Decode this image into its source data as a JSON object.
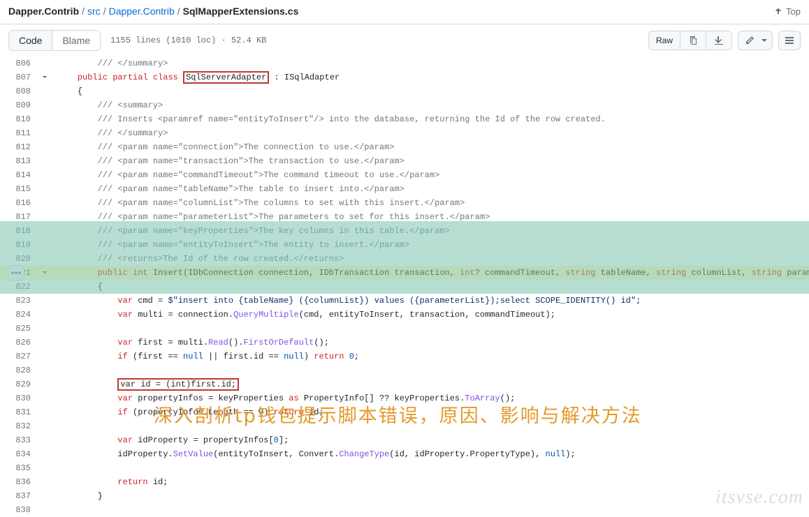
{
  "breadcrumb": {
    "items": [
      {
        "label": "Dapper.Contrib",
        "bold": true
      },
      {
        "label": "src"
      },
      {
        "label": "Dapper.Contrib"
      },
      {
        "label": "SqlMapperExtensions.cs",
        "bold": true
      }
    ],
    "sep": "/"
  },
  "top_link": "Top",
  "view_tabs": {
    "code": "Code",
    "blame": "Blame"
  },
  "file_meta": "1155 lines (1010 loc) · 52.4 KB",
  "actions": {
    "raw": "Raw"
  },
  "watermark": "itsvse.com",
  "overlay_text": "深入剖析tp钱包提示脚本错误，原因、影响与解决方法",
  "code": [
    {
      "n": "806",
      "g": "",
      "tokens": [
        {
          "t": "        ",
          "c": ""
        },
        {
          "t": "/// </summary>",
          "c": "c1"
        }
      ]
    },
    {
      "n": "807",
      "g": "chev",
      "tokens": [
        {
          "t": "    ",
          "c": ""
        },
        {
          "t": "public",
          "c": "kw"
        },
        {
          "t": " ",
          "c": ""
        },
        {
          "t": "partial",
          "c": "kw"
        },
        {
          "t": " ",
          "c": ""
        },
        {
          "t": "class",
          "c": "kw"
        },
        {
          "t": " ",
          "c": ""
        },
        {
          "t": "SqlServerAdapter",
          "c": "",
          "box": true
        },
        {
          "t": " : ISqlAdapter",
          "c": ""
        }
      ]
    },
    {
      "n": "808",
      "g": "",
      "tokens": [
        {
          "t": "    {",
          "c": ""
        }
      ]
    },
    {
      "n": "809",
      "g": "",
      "tokens": [
        {
          "t": "        ",
          "c": ""
        },
        {
          "t": "/// <summary>",
          "c": "c1"
        }
      ]
    },
    {
      "n": "810",
      "g": "",
      "tokens": [
        {
          "t": "        ",
          "c": ""
        },
        {
          "t": "/// Inserts <paramref name=\"entityToInsert\"/> into the database, returning the Id of the row created.",
          "c": "c1"
        }
      ]
    },
    {
      "n": "811",
      "g": "",
      "tokens": [
        {
          "t": "        ",
          "c": ""
        },
        {
          "t": "/// </summary>",
          "c": "c1"
        }
      ]
    },
    {
      "n": "812",
      "g": "",
      "tokens": [
        {
          "t": "        ",
          "c": ""
        },
        {
          "t": "/// <param name=\"connection\">The connection to use.</param>",
          "c": "c1"
        }
      ]
    },
    {
      "n": "813",
      "g": "",
      "tokens": [
        {
          "t": "        ",
          "c": ""
        },
        {
          "t": "/// <param name=\"transaction\">The transaction to use.</param>",
          "c": "c1"
        }
      ]
    },
    {
      "n": "814",
      "g": "",
      "tokens": [
        {
          "t": "        ",
          "c": ""
        },
        {
          "t": "/// <param name=\"commandTimeout\">The command timeout to use.</param>",
          "c": "c1"
        }
      ]
    },
    {
      "n": "815",
      "g": "",
      "tokens": [
        {
          "t": "        ",
          "c": ""
        },
        {
          "t": "/// <param name=\"tableName\">The table to insert into.</param>",
          "c": "c1"
        }
      ]
    },
    {
      "n": "816",
      "g": "",
      "tokens": [
        {
          "t": "        ",
          "c": ""
        },
        {
          "t": "/// <param name=\"columnList\">The columns to set with this insert.</param>",
          "c": "c1"
        }
      ]
    },
    {
      "n": "817",
      "g": "",
      "tokens": [
        {
          "t": "        ",
          "c": ""
        },
        {
          "t": "/// <param name=\"parameterList\">The parameters to set for this insert.</param>",
          "c": "c1"
        }
      ]
    },
    {
      "n": "818",
      "g": "",
      "tokens": [
        {
          "t": "        ",
          "c": ""
        },
        {
          "t": "/// <param name=\"keyProperties\">The key columns in this table.</param>",
          "c": "c1"
        }
      ]
    },
    {
      "n": "819",
      "g": "",
      "tokens": [
        {
          "t": "        ",
          "c": ""
        },
        {
          "t": "/// <param name=\"entityToInsert\">The entity to insert.</param>",
          "c": "c1"
        }
      ]
    },
    {
      "n": "820",
      "g": "",
      "tokens": [
        {
          "t": "        ",
          "c": ""
        },
        {
          "t": "/// <returns>The Id of the row created.</returns>",
          "c": "c1"
        }
      ]
    },
    {
      "n": "821",
      "g": "chev",
      "cur": true,
      "tokens": [
        {
          "t": "        ",
          "c": ""
        },
        {
          "t": "public",
          "c": "kw"
        },
        {
          "t": " ",
          "c": ""
        },
        {
          "t": "int",
          "c": "kw"
        },
        {
          "t": " ",
          "c": ""
        },
        {
          "t": "Insert",
          "c": "",
          "hl": true
        },
        {
          "t": "(IDbConnection connection, IDbTransaction transaction, ",
          "c": ""
        },
        {
          "t": "int",
          "c": "kw"
        },
        {
          "t": "? commandTimeout, ",
          "c": ""
        },
        {
          "t": "string",
          "c": "kw"
        },
        {
          "t": " tableName, ",
          "c": ""
        },
        {
          "t": "string",
          "c": "kw"
        },
        {
          "t": " columnList, ",
          "c": ""
        },
        {
          "t": "string",
          "c": "kw"
        },
        {
          "t": " parameterList, IEnum",
          "c": ""
        }
      ]
    },
    {
      "n": "822",
      "g": "",
      "tokens": [
        {
          "t": "        {",
          "c": ""
        }
      ]
    },
    {
      "n": "823",
      "g": "",
      "tokens": [
        {
          "t": "            ",
          "c": ""
        },
        {
          "t": "var",
          "c": "kw"
        },
        {
          "t": " cmd = ",
          "c": ""
        },
        {
          "t": "$\"insert into {tableName} ({columnList}) values ({parameterList});select SCOPE_IDENTITY() id\"",
          "c": "st"
        },
        {
          "t": ";",
          "c": ""
        }
      ]
    },
    {
      "n": "824",
      "g": "",
      "tokens": [
        {
          "t": "            ",
          "c": ""
        },
        {
          "t": "var",
          "c": "kw"
        },
        {
          "t": " multi = connection.",
          "c": ""
        },
        {
          "t": "QueryMultiple",
          "c": "fn"
        },
        {
          "t": "(cmd, entityToInsert, transaction, commandTimeout);",
          "c": ""
        }
      ]
    },
    {
      "n": "825",
      "g": "",
      "tokens": []
    },
    {
      "n": "826",
      "g": "",
      "tokens": [
        {
          "t": "            ",
          "c": ""
        },
        {
          "t": "var",
          "c": "kw"
        },
        {
          "t": " first = multi.",
          "c": ""
        },
        {
          "t": "Read",
          "c": "fn"
        },
        {
          "t": "().",
          "c": ""
        },
        {
          "t": "FirstOrDefault",
          "c": "fn"
        },
        {
          "t": "();",
          "c": ""
        }
      ]
    },
    {
      "n": "827",
      "g": "",
      "tokens": [
        {
          "t": "            ",
          "c": ""
        },
        {
          "t": "if",
          "c": "kw"
        },
        {
          "t": " (first == ",
          "c": ""
        },
        {
          "t": "null",
          "c": "nm"
        },
        {
          "t": " || first.id == ",
          "c": ""
        },
        {
          "t": "null",
          "c": "nm"
        },
        {
          "t": ") ",
          "c": ""
        },
        {
          "t": "return",
          "c": "kw"
        },
        {
          "t": " ",
          "c": ""
        },
        {
          "t": "0",
          "c": "nm"
        },
        {
          "t": ";",
          "c": ""
        }
      ]
    },
    {
      "n": "828",
      "g": "",
      "tokens": []
    },
    {
      "n": "829",
      "g": "",
      "tokens": [
        {
          "t": "            ",
          "c": ""
        },
        {
          "t": "var id = (int)first.id;",
          "c": "",
          "box": true
        }
      ]
    },
    {
      "n": "830",
      "g": "",
      "tokens": [
        {
          "t": "            ",
          "c": ""
        },
        {
          "t": "var",
          "c": "kw"
        },
        {
          "t": " propertyInfos = keyProperties ",
          "c": ""
        },
        {
          "t": "as",
          "c": "kw"
        },
        {
          "t": " PropertyInfo[] ?? keyProperties.",
          "c": ""
        },
        {
          "t": "ToArray",
          "c": "fn"
        },
        {
          "t": "();",
          "c": ""
        }
      ]
    },
    {
      "n": "831",
      "g": "",
      "tokens": [
        {
          "t": "            ",
          "c": ""
        },
        {
          "t": "if",
          "c": "kw"
        },
        {
          "t": " (propertyInfos.Length == ",
          "c": ""
        },
        {
          "t": "0",
          "c": "nm"
        },
        {
          "t": ") ",
          "c": ""
        },
        {
          "t": "return",
          "c": "kw"
        },
        {
          "t": " id;",
          "c": ""
        }
      ]
    },
    {
      "n": "832",
      "g": "",
      "tokens": []
    },
    {
      "n": "833",
      "g": "",
      "tokens": [
        {
          "t": "            ",
          "c": ""
        },
        {
          "t": "var",
          "c": "kw"
        },
        {
          "t": " idProperty = propertyInfos[",
          "c": ""
        },
        {
          "t": "0",
          "c": "nm"
        },
        {
          "t": "];",
          "c": ""
        }
      ]
    },
    {
      "n": "834",
      "g": "",
      "tokens": [
        {
          "t": "            idProperty.",
          "c": ""
        },
        {
          "t": "SetValue",
          "c": "fn"
        },
        {
          "t": "(entityToInsert, Convert.",
          "c": ""
        },
        {
          "t": "ChangeType",
          "c": "fn"
        },
        {
          "t": "(id, idProperty.PropertyType), ",
          "c": ""
        },
        {
          "t": "null",
          "c": "nm"
        },
        {
          "t": ");",
          "c": ""
        }
      ]
    },
    {
      "n": "835",
      "g": "",
      "tokens": []
    },
    {
      "n": "836",
      "g": "",
      "tokens": [
        {
          "t": "            ",
          "c": ""
        },
        {
          "t": "return",
          "c": "kw"
        },
        {
          "t": " id;",
          "c": ""
        }
      ]
    },
    {
      "n": "837",
      "g": "",
      "tokens": [
        {
          "t": "        }",
          "c": ""
        }
      ]
    },
    {
      "n": "838",
      "g": "",
      "tokens": []
    }
  ]
}
